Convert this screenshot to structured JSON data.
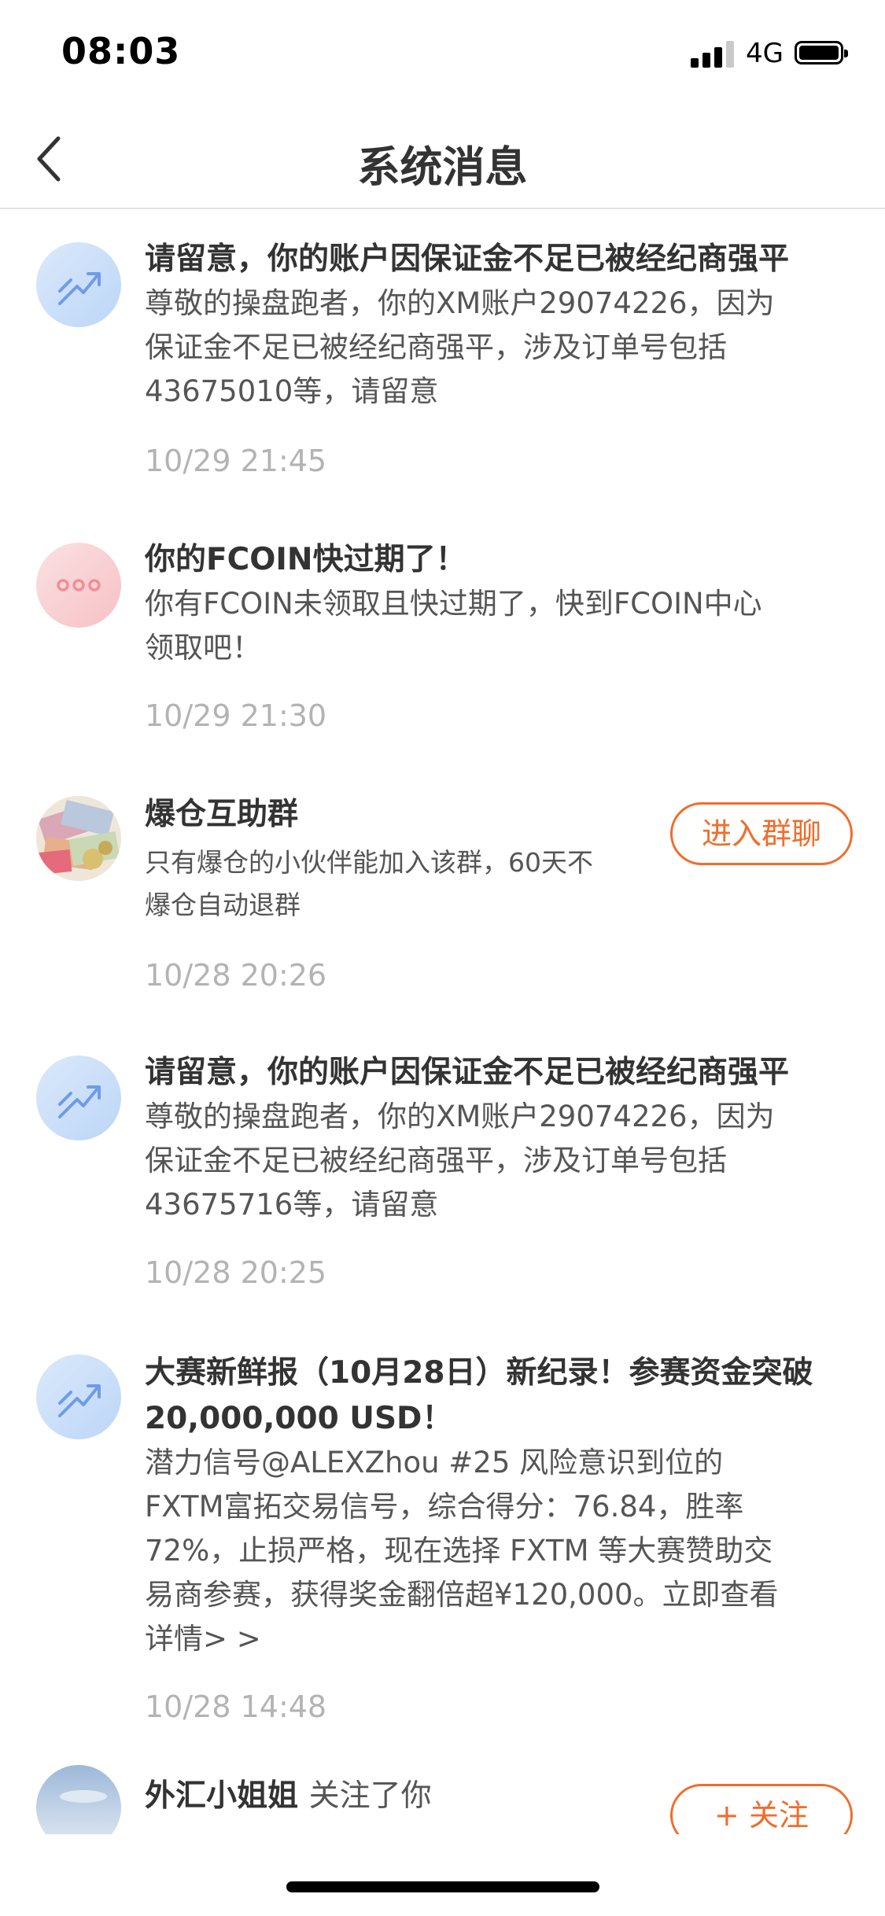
{
  "status": {
    "time": "08:03",
    "network": "4G"
  },
  "header": {
    "title": "系统消息"
  },
  "messages": [
    {
      "title": "请留意，你的账户因保证金不足已被经纪商强平",
      "body": [
        "尊敬的操盘跑者，你的XM账户29074226，因为",
        "保证金不足已被经纪商强平，涉及订单号包括",
        "43675010等，请留意"
      ],
      "time": "10/29 21:45"
    },
    {
      "title": "你的FCOIN快过期了！",
      "body": [
        "你有FCOIN未领取且快过期了，快到FCOIN中心",
        "领取吧！"
      ],
      "time": "10/29 21:30"
    },
    {
      "title": "爆仓互助群",
      "body": [
        "只有爆仓的小伙伴能加入该群，60天不",
        "爆仓自动退群"
      ],
      "time": "10/28 20:26",
      "button": "进入群聊"
    },
    {
      "title": "请留意，你的账户因保证金不足已被经纪商强平",
      "body": [
        "尊敬的操盘跑者，你的XM账户29074226，因为",
        "保证金不足已被经纪商强平，涉及订单号包括",
        "43675716等，请留意"
      ],
      "time": "10/28 20:25"
    },
    {
      "title": [
        "大赛新鲜报（10月28日）新纪录！参赛资金突破",
        "20,000,000 USD！"
      ],
      "body": [
        "潜力信号@ALEXZhou #25 风险意识到位的",
        "FXTM富拓交易信号，综合得分：76.84，胜率",
        "72%，止损严格，现在选择 FXTM 等大赛赞助交",
        "易商参赛，获得奖金翻倍超¥120,000。立即查看",
        "详情>  >"
      ],
      "time": "10/28 14:48"
    },
    {
      "name": "外汇小姐姐",
      "action": "关注了你",
      "button": "+ 关注"
    }
  ],
  "colors": {
    "accent": "#f06d2c",
    "time_gray": "#b3b3b3",
    "icon_blue": "#6f9be8",
    "icon_pink": "#ef8f96"
  },
  "icons": [
    "signal-icon",
    "battery-icon",
    "back-arrow-icon",
    "trend-arrow-icon",
    "dots-icon",
    "banknotes-avatar",
    "sky-avatar"
  ]
}
